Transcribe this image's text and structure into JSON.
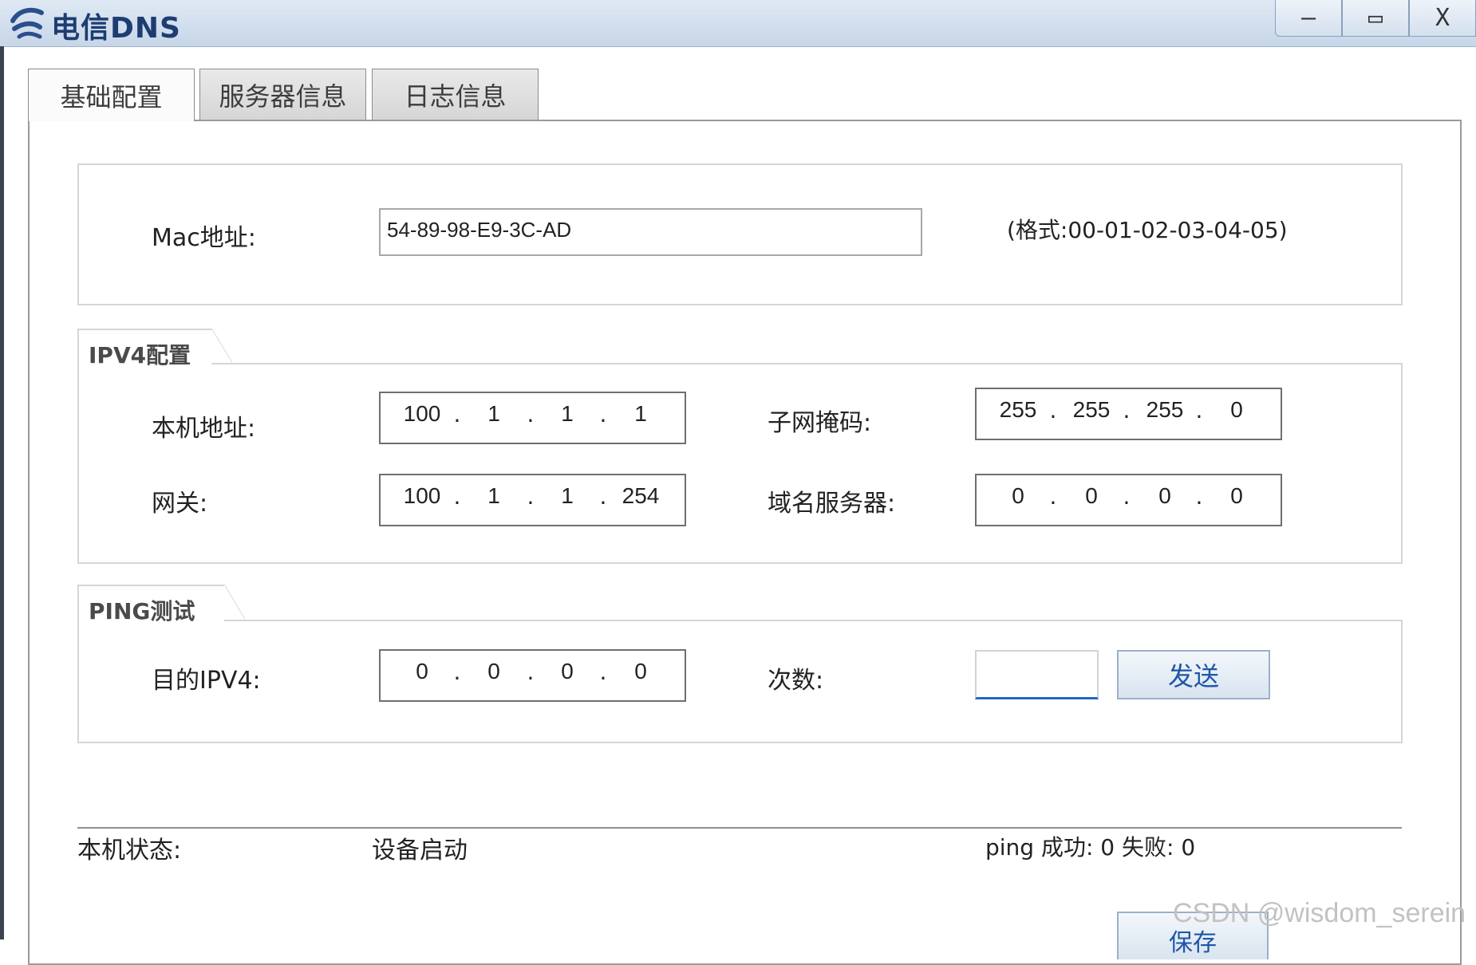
{
  "window": {
    "title": "电信DNS",
    "minimize_glyph": "—",
    "maximize_glyph": "▭",
    "close_glyph": "X",
    "title_color": "#1d3d72"
  },
  "tabs": [
    {
      "label": "基础配置",
      "active": true
    },
    {
      "label": "服务器信息",
      "active": false
    },
    {
      "label": "日志信息",
      "active": false
    }
  ],
  "mac": {
    "label": "Mac地址:",
    "value": "54-89-98-E9-3C-AD",
    "hint": "(格式:00-01-02-03-04-05)"
  },
  "ipv4": {
    "group_title": "IPV4配置",
    "local_ip": {
      "label": "本机地址:",
      "segments": [
        "100",
        "1",
        "1",
        "1"
      ]
    },
    "subnet_mask": {
      "label": "子网掩码:",
      "segments": [
        "255",
        "255",
        "255",
        "0"
      ]
    },
    "gateway": {
      "label": "网关:",
      "segments": [
        "100",
        "1",
        "1",
        "254"
      ]
    },
    "dns_server": {
      "label": "域名服务器:",
      "segments": [
        "0",
        "0",
        "0",
        "0"
      ]
    }
  },
  "ping": {
    "group_title": "PING测试",
    "dest_ip": {
      "label": "目的IPV4:",
      "segments": [
        "0",
        "0",
        "0",
        "0"
      ]
    },
    "count_label": "次数:",
    "count_value": "",
    "send_label": "发送"
  },
  "status": {
    "label": "本机状态:",
    "value": "设备启动",
    "ping_result": "ping 成功: 0 失败: 0"
  },
  "save_label": "保存",
  "watermark": "CSDN @wisdom_serein",
  "colors": {
    "accent": "#1f67c8",
    "button_text": "#1e56a6"
  }
}
